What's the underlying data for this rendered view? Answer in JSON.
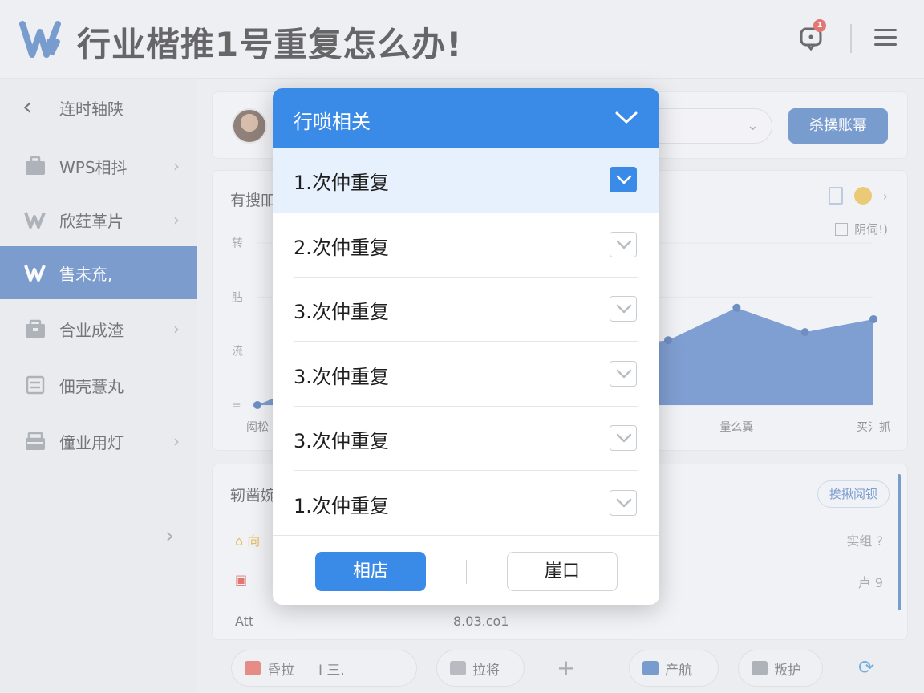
{
  "header": {
    "title": "行业楷推1号重复怎么办!",
    "notification_count": "1"
  },
  "sidebar": {
    "back_label": "连时轴陕",
    "items": [
      {
        "label": "WPS相抖"
      },
      {
        "label": "欣荭革片"
      },
      {
        "label": "售未㐬,"
      },
      {
        "label": "合业成渣"
      },
      {
        "label": "佃壳薏丸"
      },
      {
        "label": "僮业用灯"
      }
    ]
  },
  "main": {
    "user_card": {
      "action_button": "杀操账幂"
    },
    "chart_card": {
      "title": "有搜吅",
      "legend_label": "阴伺!)"
    },
    "list_card": {
      "title": "轫凿婉",
      "filter_label": "挨揪阅钡",
      "rows": [
        {
          "left": "向",
          "right": "实组 ?"
        },
        {
          "left": "",
          "right": "卢 9"
        },
        {
          "left": "Att",
          "middle": "8.03.co1",
          "right": ""
        }
      ]
    },
    "bottom_bar": {
      "pill1_label": "昏拉",
      "pill1_extra": "I  三.",
      "pill2_label": "拉将",
      "pill3_label": "产航",
      "pill4_label": "叛护"
    }
  },
  "chart_data": {
    "type": "area",
    "y_tick_labels": [
      "=",
      "㳘",
      "胋",
      "转"
    ],
    "x": [
      "闳松",
      "",
      "",
      "",
      "",
      "",
      "",
      "量么翼",
      "",
      "买氵抓"
    ],
    "values": [
      0,
      0.18,
      0.15,
      0.22,
      0.3,
      0.35,
      0.4,
      0.6,
      0.45,
      0.53
    ],
    "series_color": "#2f64b8",
    "ylim": [
      0,
      1
    ],
    "grid": true
  },
  "modal": {
    "title": "行唢相关",
    "options": [
      {
        "label": "1.次仲重复",
        "checked": true
      },
      {
        "label": "2.次仲重复",
        "checked": false
      },
      {
        "label": "3.次仲重复",
        "checked": false
      },
      {
        "label": "3.次仲重复",
        "checked": false
      },
      {
        "label": "3.次仲重复",
        "checked": false
      },
      {
        "label": "1.次仲重复",
        "checked": false
      }
    ],
    "confirm_label": "相店",
    "cancel_label": "崖口"
  },
  "colors": {
    "accent": "#3a8ae8",
    "sidebar_active": "#3e6fb7",
    "badge": "#d9352b"
  }
}
